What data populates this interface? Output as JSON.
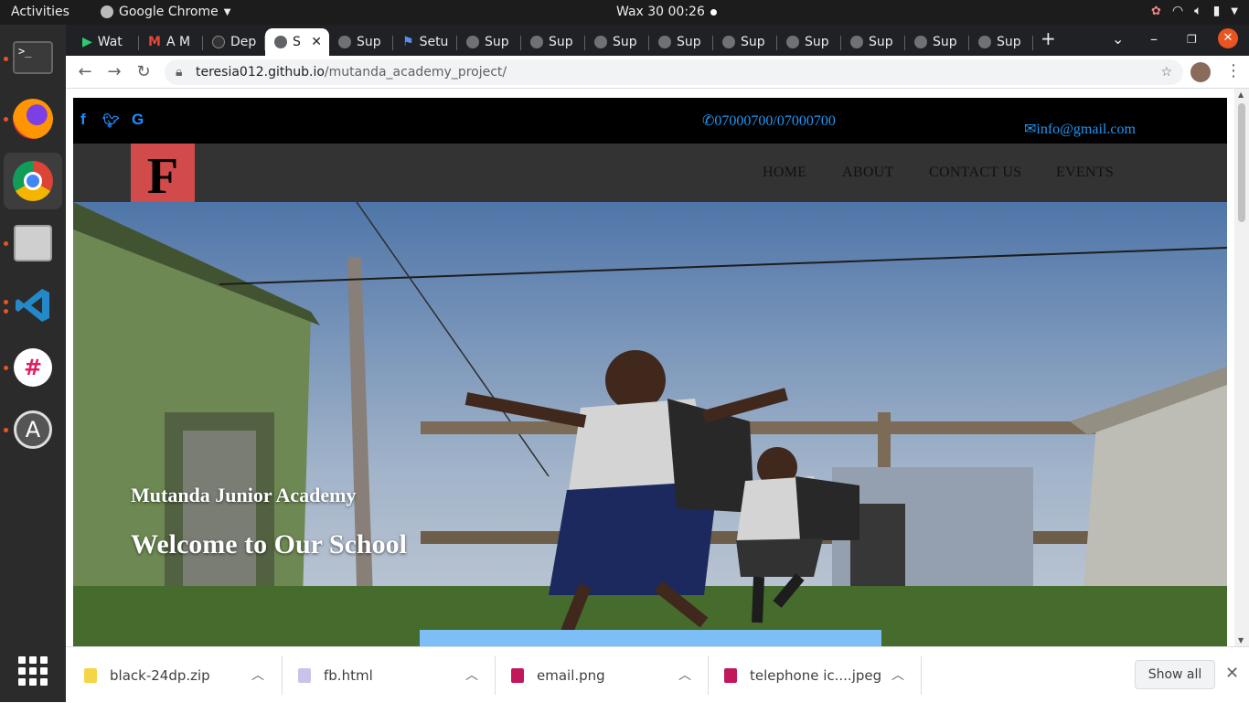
{
  "system": {
    "activities": "Activities",
    "app_name": "Google Chrome",
    "clock": "Wax 30  00:26"
  },
  "dock": {
    "items": [
      "terminal",
      "firefox",
      "chrome",
      "files",
      "vscode",
      "slack",
      "software-updater"
    ]
  },
  "tabs": [
    {
      "label": "Wat"
    },
    {
      "label": "A M"
    },
    {
      "label": "Dep"
    },
    {
      "label": "S",
      "active": true
    },
    {
      "label": "Sup"
    },
    {
      "label": "Setu"
    },
    {
      "label": "Sup"
    },
    {
      "label": "Sup"
    },
    {
      "label": "Sup"
    },
    {
      "label": "Sup"
    },
    {
      "label": "Sup"
    },
    {
      "label": "Sup"
    },
    {
      "label": "Sup"
    },
    {
      "label": "Sup"
    },
    {
      "label": "Sup"
    }
  ],
  "browser": {
    "url_host": "teresia012.github.io",
    "url_path": "/mutanda_academy_project/",
    "new_tab": "+"
  },
  "site": {
    "social": [
      "f",
      "t",
      "G"
    ],
    "phone": "07000700/07000700",
    "email": "info@gmail.com",
    "logo": "F",
    "nav": [
      "HOME",
      "ABOUT",
      "CONTACT US",
      "EVENTS"
    ],
    "hero_subtitle": "Mutanda Junior Academy",
    "hero_title": "Welcome to Our School"
  },
  "downloads": [
    {
      "name": "black-24dp.zip",
      "color": "#f5d547"
    },
    {
      "name": "fb.html",
      "color": "#c9c3ea"
    },
    {
      "name": "email.png",
      "color": "#c2185b"
    },
    {
      "name": "telephone ic....jpeg",
      "color": "#c2185b"
    }
  ],
  "shelf": {
    "show_all": "Show all"
  },
  "colors": {
    "accent_blue": "#1e90ff",
    "logo_red": "#d14b4b",
    "nav_bg": "#333333",
    "hero_button": "#7cbef5"
  }
}
